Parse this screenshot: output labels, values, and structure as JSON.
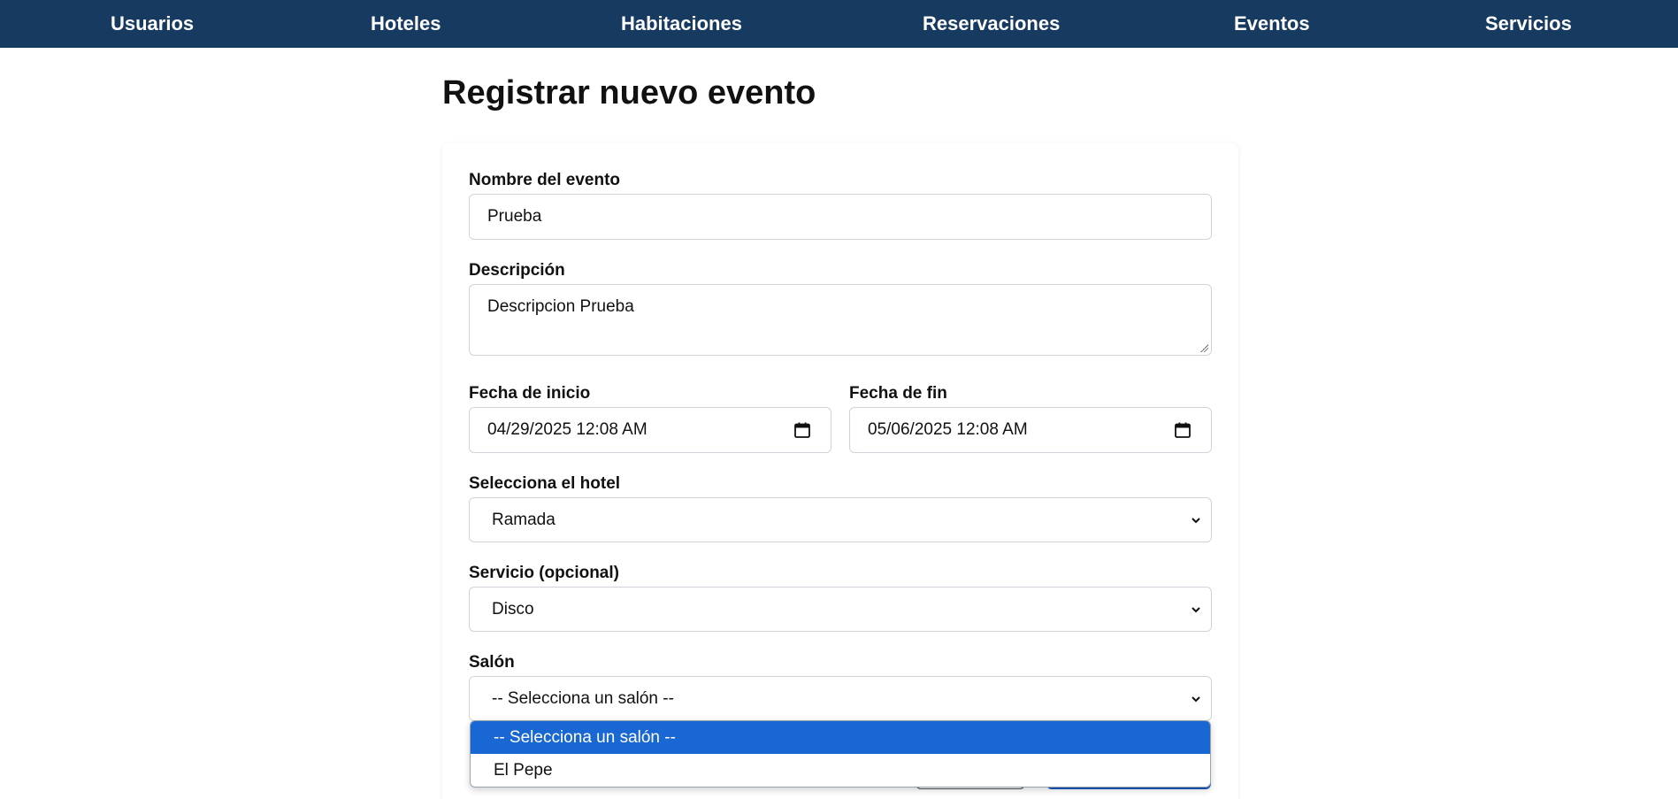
{
  "nav": {
    "items": [
      {
        "label": "Usuarios"
      },
      {
        "label": "Hoteles"
      },
      {
        "label": "Habitaciones"
      },
      {
        "label": "Reservaciones"
      },
      {
        "label": "Eventos"
      },
      {
        "label": "Servicios"
      }
    ]
  },
  "page": {
    "title": "Registrar nuevo evento"
  },
  "form": {
    "name": {
      "label": "Nombre del evento",
      "value": "Prueba"
    },
    "description": {
      "label": "Descripción",
      "value": "Descripcion Prueba"
    },
    "start": {
      "label": "Fecha de inicio",
      "value": "04/29/2025 12:08 AM"
    },
    "end": {
      "label": "Fecha de fin",
      "value": "05/06/2025 12:08 AM"
    },
    "hotel": {
      "label": "Selecciona el hotel",
      "value": "Ramada"
    },
    "service": {
      "label": "Servicio (opcional)",
      "value": "Disco"
    },
    "salon": {
      "label": "Salón",
      "value": "-- Selecciona un salón --",
      "options": [
        "-- Selecciona un salón --",
        "El Pepe"
      ]
    }
  },
  "colors": {
    "nav_bg": "#173a61",
    "selected_option": "#1967d2"
  },
  "icons": {
    "calendar": "calendar-icon",
    "chevron": "chevron-down-icon"
  }
}
